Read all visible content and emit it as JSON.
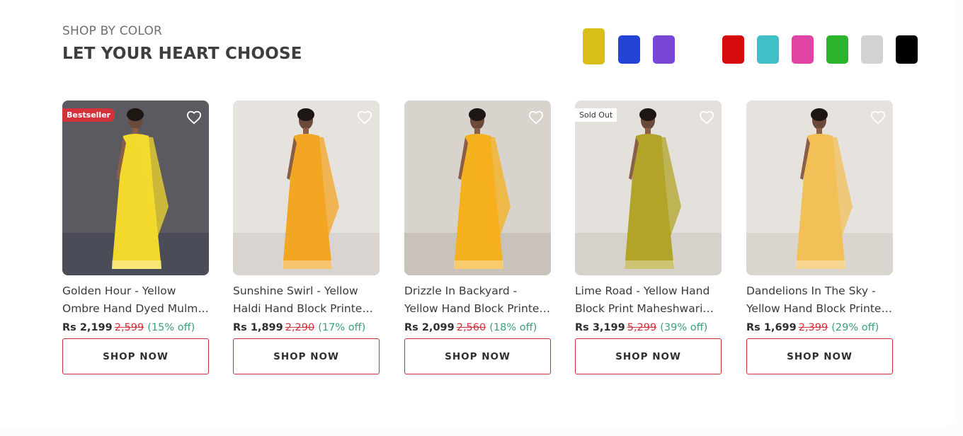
{
  "section": {
    "eyebrow": "SHOP BY COLOR",
    "heading": "LET YOUR HEART CHOOSE"
  },
  "colors": {
    "swatches": [
      {
        "name": "yellow",
        "hex": "#d8be16",
        "selected": true
      },
      {
        "name": "blue",
        "hex": "#2444d8",
        "selected": false
      },
      {
        "name": "purple",
        "hex": "#7a46d8",
        "selected": false
      },
      {
        "name": "red",
        "hex": "#d60a0a",
        "selected": false
      },
      {
        "name": "teal",
        "hex": "#3fbfc6",
        "selected": false
      },
      {
        "name": "pink",
        "hex": "#e244a6",
        "selected": false
      },
      {
        "name": "green",
        "hex": "#2cb42c",
        "selected": false
      },
      {
        "name": "grey",
        "hex": "#d2d2d2",
        "selected": false
      },
      {
        "name": "black",
        "hex": "#000000",
        "selected": false
      }
    ],
    "accent_red": "#d4323a",
    "discount_green": "#3aa07e"
  },
  "products": [
    {
      "badge": "Bestseller",
      "title": "Golden Hour - Yellow Ombre Hand Dyed Mulmul Saree",
      "price": "Rs 2,199",
      "mrp": "2,599",
      "discount": "(15% off)",
      "cta": "SHOP NOW",
      "wall": "#5b5a60",
      "floor": "#4a4d58",
      "saree": "#f3d92c",
      "icon": "heart-icon"
    },
    {
      "badge": "",
      "title": "Sunshine Swirl - Yellow Haldi Hand Block Printed Saree",
      "price": "Rs 1,899",
      "mrp": "2,290",
      "discount": "(17% off)",
      "cta": "SHOP NOW",
      "wall": "#e6e3df",
      "floor": "#d9d4cf",
      "saree": "#f3a623",
      "icon": "heart-icon"
    },
    {
      "badge": "",
      "title": "Drizzle In Backyard - Yellow Hand Block Printed Saree",
      "price": "Rs 2,099",
      "mrp": "2,560",
      "discount": "(18% off)",
      "cta": "SHOP NOW",
      "wall": "#d9d3cd",
      "floor": "#c9c2ba",
      "saree": "#f5b01e",
      "icon": "heart-icon"
    },
    {
      "badge": "Sold Out",
      "title": "Lime Road - Yellow Hand Block Print Maheshwari Saree",
      "price": "Rs 3,199",
      "mrp": "5,299",
      "discount": "(39% off)",
      "cta": "SHOP NOW",
      "wall": "#e4e1dc",
      "floor": "#d6d1cb",
      "saree": "#b1a428",
      "icon": "heart-icon"
    },
    {
      "badge": "",
      "title": "Dandelions In The Sky - Yellow Hand Block Printed Saree",
      "price": "Rs 1,699",
      "mrp": "2,399",
      "discount": "(29% off)",
      "cta": "SHOP NOW",
      "wall": "#e6e3df",
      "floor": "#dad5cf",
      "saree": "#f3bf57",
      "icon": "heart-icon"
    }
  ]
}
